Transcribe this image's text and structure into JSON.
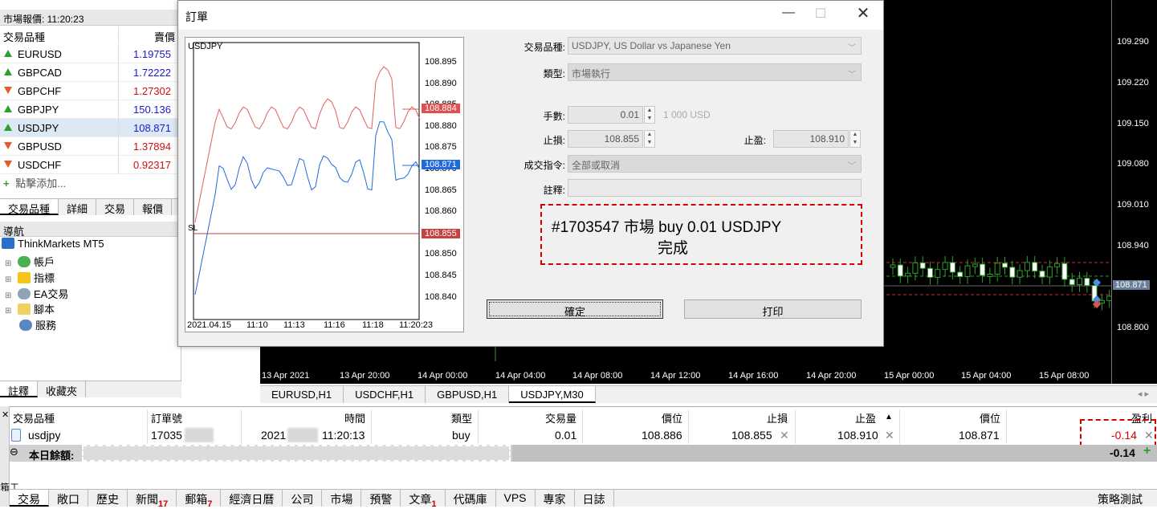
{
  "market_watch": {
    "title": "市場報價: 11:20:23",
    "col_symbol": "交易品種",
    "col_bid": "賣價",
    "rows": [
      {
        "symbol": "EURUSD",
        "bid": "1.19755",
        "dir": "up",
        "bid_color": "#1a1acc"
      },
      {
        "symbol": "GBPCAD",
        "bid": "1.72222",
        "dir": "up",
        "bid_color": "#1a1acc"
      },
      {
        "symbol": "GBPCHF",
        "bid": "1.27302",
        "dir": "down",
        "bid_color": "#d01010"
      },
      {
        "symbol": "GBPJPY",
        "bid": "150.136",
        "dir": "up",
        "bid_color": "#1a1acc"
      },
      {
        "symbol": "USDJPY",
        "bid": "108.871",
        "dir": "up",
        "bid_color": "#1a1acc"
      },
      {
        "symbol": "GBPUSD",
        "bid": "1.37894",
        "dir": "down",
        "bid_color": "#d01010"
      },
      {
        "symbol": "USDCHF",
        "bid": "0.92317",
        "dir": "down",
        "bid_color": "#d01010"
      }
    ],
    "add_label": "點擊添加...",
    "tabs": [
      "交易品種",
      "詳細",
      "交易",
      "報價"
    ]
  },
  "navigator": {
    "title": "導航",
    "root": "ThinkMarkets MT5",
    "items": [
      "帳戶",
      "指標",
      "EA交易",
      "腳本",
      "服務"
    ],
    "tabs": [
      "註釋",
      "收藏夾"
    ]
  },
  "chart": {
    "y_labels": [
      "109.290",
      "109.220",
      "109.150",
      "109.080",
      "109.010",
      "108.940",
      "108.871",
      "108.800"
    ],
    "x_labels": [
      "13 Apr 2021",
      "13 Apr 20:00",
      "14 Apr 00:00",
      "14 Apr 04:00",
      "14 Apr 08:00",
      "14 Apr 12:00",
      "14 Apr 16:00",
      "14 Apr 20:00",
      "15 Apr 00:00",
      "15 Apr 04:00",
      "15 Apr 08:00"
    ],
    "tabs": [
      "EURUSD,H1",
      "USDCHF,H1",
      "GBPUSD,H1",
      "USDJPY,M30"
    ]
  },
  "dialog": {
    "title": "訂單",
    "mini_chart": {
      "symbol": "USDJPY",
      "sl_label": "SL",
      "y_ticks": [
        "108.895",
        "108.890",
        "108.885",
        "108.880",
        "108.875",
        "108.870",
        "108.865",
        "108.860",
        "108.855",
        "108.850",
        "108.845",
        "108.840"
      ],
      "ask_value": "108.884",
      "bid_value": "108.871",
      "sl_value": "108.855",
      "x_labels": [
        "2021.04.15",
        "11:10",
        "11:13",
        "11:16",
        "11:18",
        "11:20:23"
      ]
    },
    "symbol_label": "交易品種:",
    "symbol_value": "USDJPY, US Dollar vs Japanese Yen",
    "type_label": "類型:",
    "type_value": "市場執行",
    "volume_label": "手數:",
    "volume_value": "0.01",
    "volume_hint": "1 000 USD",
    "sl_label": "止損:",
    "sl_value": "108.855",
    "tp_label": "止盈:",
    "tp_value": "108.910",
    "fill_label": "成交指令:",
    "fill_value": "全部或取消",
    "comment_label": "註釋:",
    "result_line1": "#1703547 市場 buy 0.01 USDJPY",
    "result_line2": "完成",
    "ok_button": "確定",
    "print_button": "打印"
  },
  "toolbox": {
    "headers": {
      "symbol": "交易品種",
      "ticket": "訂單號",
      "time": "時間",
      "type": "類型",
      "volume": "交易量",
      "price": "價位",
      "sl": "止損",
      "tp": "止盈",
      "cur_price": "價位",
      "profit": "盈利"
    },
    "row": {
      "symbol": "usdjpy",
      "ticket": "17035",
      "time_prefix": "2021",
      "time": "11:20:13",
      "type": "buy",
      "volume": "0.01",
      "price": "108.886",
      "sl": "108.855",
      "tp": "108.910",
      "cur_price": "108.871",
      "profit": "-0.14"
    },
    "balance_label": "本日餘額: ",
    "balance_profit": "-0.14",
    "side_label": "工具箱",
    "tabs": [
      {
        "label": "交易",
        "badge": ""
      },
      {
        "label": "敞口",
        "badge": ""
      },
      {
        "label": "歷史",
        "badge": ""
      },
      {
        "label": "新聞",
        "badge": "17"
      },
      {
        "label": "郵箱",
        "badge": "7"
      },
      {
        "label": "經濟日曆",
        "badge": ""
      },
      {
        "label": "公司",
        "badge": ""
      },
      {
        "label": "市場",
        "badge": ""
      },
      {
        "label": "預警",
        "badge": ""
      },
      {
        "label": "文章",
        "badge": "1"
      },
      {
        "label": "代碼庫",
        "badge": ""
      },
      {
        "label": "VPS",
        "badge": ""
      },
      {
        "label": "專家",
        "badge": ""
      },
      {
        "label": "日誌",
        "badge": ""
      }
    ],
    "strategy_tester": "策略測試"
  }
}
